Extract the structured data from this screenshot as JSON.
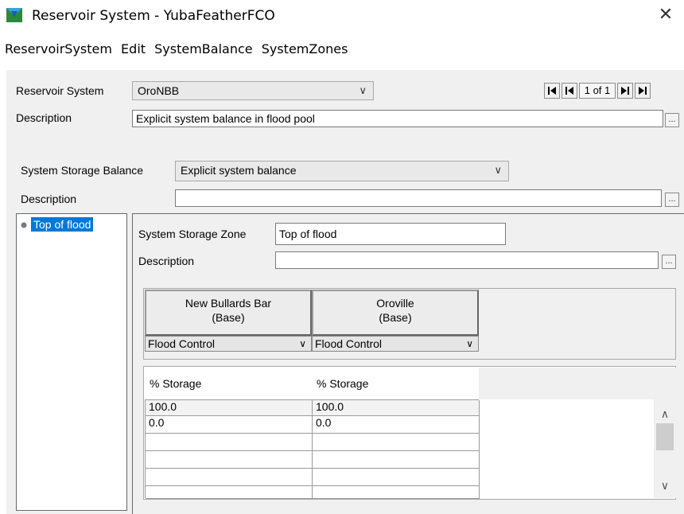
{
  "window": {
    "title": "Reservoir System - YubaFeatherFCO",
    "close_glyph": "✕"
  },
  "menu": [
    "ReservoirSystem",
    "Edit",
    "SystemBalance",
    "SystemZones"
  ],
  "reservoir_system": {
    "label": "Reservoir System",
    "value": "OroNBB",
    "description_label": "Description",
    "description": "Explicit system balance in flood pool",
    "record_nav": "1 of 1"
  },
  "balance": {
    "label": "System Storage Balance",
    "value": "Explicit system balance",
    "description_label": "Description",
    "description": ""
  },
  "zones": {
    "items": [
      "Top of flood"
    ],
    "selected": "Top of flood"
  },
  "zone": {
    "label": "System Storage Zone",
    "value": "Top of flood",
    "description_label": "Description",
    "description": ""
  },
  "table": {
    "columns": [
      {
        "name_line1": "New Bullards Bar",
        "name_line2": "(Base)",
        "rule": "Flood Control",
        "sub_header": "% Storage"
      },
      {
        "name_line1": "Oroville",
        "name_line2": "(Base)",
        "rule": "Flood Control",
        "sub_header": "% Storage"
      }
    ],
    "rows": [
      [
        "100.0",
        "100.0"
      ],
      [
        "0.0",
        "0.0"
      ],
      [
        "",
        ""
      ],
      [
        "",
        ""
      ],
      [
        "",
        ""
      ],
      [
        "",
        ""
      ]
    ]
  },
  "colors": {
    "selection": "#0078d7",
    "panel_bg": "#f0f0f0"
  }
}
